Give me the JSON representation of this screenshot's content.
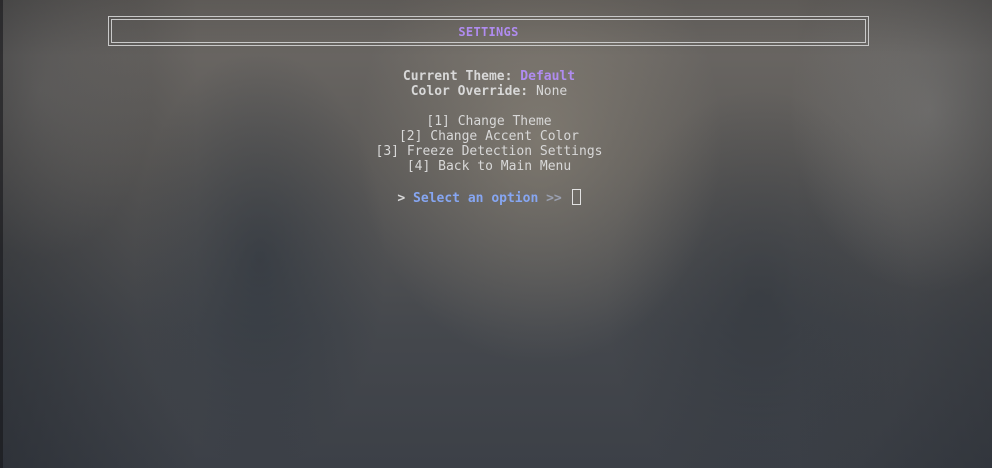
{
  "header": {
    "title": "SETTINGS"
  },
  "status": {
    "theme_label": "Current Theme:",
    "theme_value": "Default",
    "override_label": "Color Override:",
    "override_value": "None"
  },
  "menu": {
    "items": [
      {
        "key": "[1]",
        "label": "Change Theme"
      },
      {
        "key": "[2]",
        "label": "Change Accent Color"
      },
      {
        "key": "[3]",
        "label": "Freeze Detection Settings"
      },
      {
        "key": "[4]",
        "label": "Back to Main Menu"
      }
    ]
  },
  "prompt": {
    "arrow": ">",
    "text": "Select an option",
    "chevrons": ">>"
  },
  "colors": {
    "accent": "#b08cf0",
    "prompt": "#86a6f2",
    "text": "#d8d8d8",
    "border": "#c9c9c9"
  }
}
